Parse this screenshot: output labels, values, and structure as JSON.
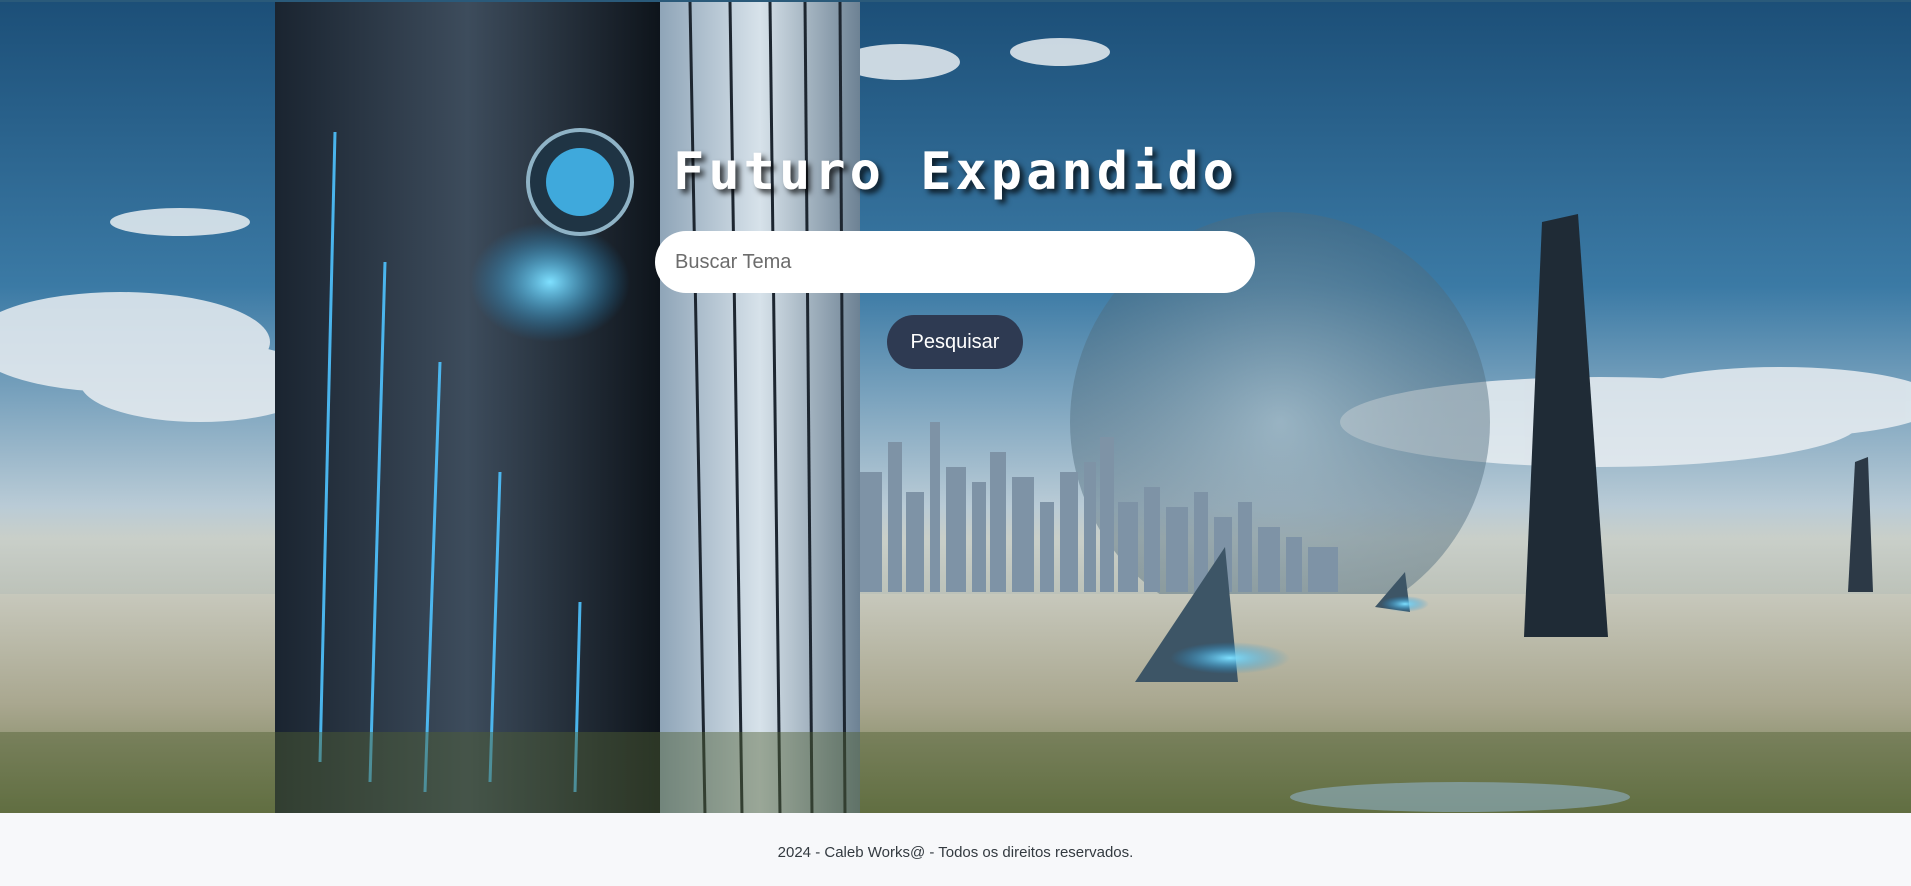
{
  "hero": {
    "title": "Futuro Expandido",
    "search_placeholder": "Buscar Tema",
    "search_value": "",
    "search_button_label": "Pesquisar"
  },
  "footer": {
    "text": "2024 - Caleb Works@ - Todos os direitos reservados."
  },
  "colors": {
    "button_bg": "#2e3a52",
    "footer_bg": "#f7f8fa",
    "sky": "#2f6f9b"
  }
}
